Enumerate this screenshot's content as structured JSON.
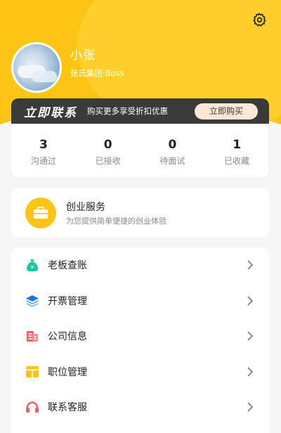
{
  "profile": {
    "name": "小张",
    "company": "张氏集团·Boss"
  },
  "icons": {
    "settings": "gear-icon",
    "service": "briefcase-icon",
    "arrow": "chevron-right-icon"
  },
  "promo": {
    "title": "立即联系",
    "text": "购买更多享受折扣优惠",
    "button": "立即购买"
  },
  "stats": [
    {
      "value": "3",
      "label": "沟通过"
    },
    {
      "value": "0",
      "label": "已接收"
    },
    {
      "value": "0",
      "label": "待面试"
    },
    {
      "value": "1",
      "label": "已收藏"
    }
  ],
  "service": {
    "title": "创业服务",
    "subtitle": "为您提供简单便捷的创业体验"
  },
  "menu": [
    {
      "label": "老板查账",
      "icon": "money-bag-icon"
    },
    {
      "label": "开票管理",
      "icon": "layers-icon"
    },
    {
      "label": "公司信息",
      "icon": "building-icon"
    },
    {
      "label": "职位管理",
      "icon": "table-icon"
    },
    {
      "label": "联系客服",
      "icon": "headset-icon"
    }
  ],
  "colors": {
    "brand_yellow": "#fcc413",
    "promo_dark": "#3a3a3a",
    "promo_button": "#fbe7d6"
  }
}
